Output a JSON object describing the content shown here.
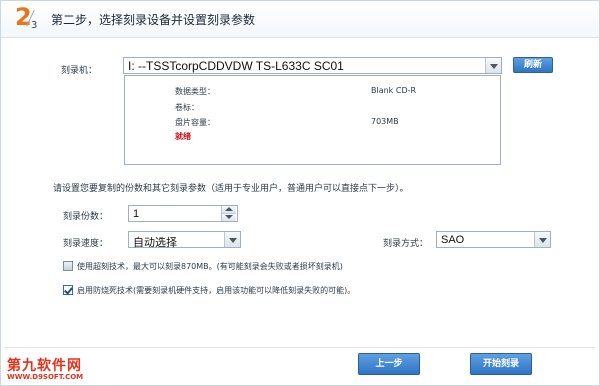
{
  "header": {
    "step_current": "2",
    "step_total": "3",
    "title": "第二步，选择刻录设备并设置刻录参数"
  },
  "device": {
    "label": "刻录机：",
    "selected": "I:  --TSSTcorpCDDVDW TS-L633C  SC01",
    "refresh_label": "刷新"
  },
  "info": {
    "data_type_key": "数据类型：",
    "data_type_value": "Blank CD-R",
    "volume_key": "卷标：",
    "capacity_key": "盘片容量：",
    "capacity_value": "703MB",
    "status": "就绪"
  },
  "hint": "请设置您要复制的份数和其它刻录参数（适用于专业用户，普通用户可以直接点下一步）。",
  "copies": {
    "label": "刻录份数：",
    "value": "1"
  },
  "speed": {
    "label": "刻录速度：",
    "value": "自动选择"
  },
  "mode": {
    "label": "刻录方式：",
    "value": "SAO"
  },
  "options": [
    {
      "label": "使用超刻技术，最大可以刻录870MB。(有可能刻录会失败或者损坏刻录机)",
      "checked": false
    },
    {
      "label": "启用防烧死技术(需要刻录机硬件支持，启用该功能可以降低刻录失败的可能)。",
      "checked": true
    }
  ],
  "brand": {
    "name": "第九软件网",
    "url": "WWW.D9SOFT.COM"
  },
  "footer": {
    "prev_label": "上一步",
    "start_label": "开始刻录"
  },
  "colors": {
    "accent": "#e8741c",
    "button": "#2f74c6",
    "status_error": "#d0101a",
    "brand": "#e4321c"
  }
}
